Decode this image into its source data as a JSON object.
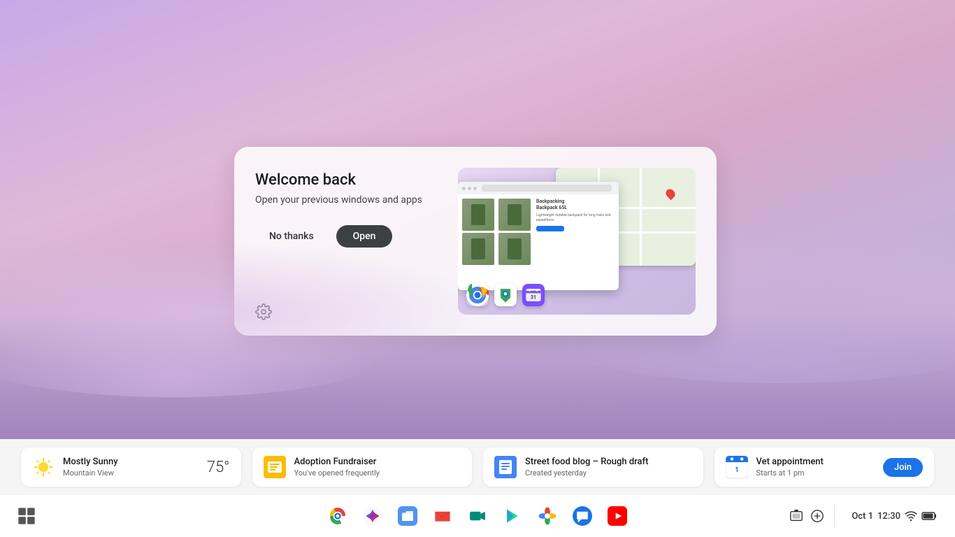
{
  "desktop": {
    "wallpaper_description": "purple pink pastel gradient with misty clouds"
  },
  "welcome_card": {
    "title": "Welcome back",
    "subtitle": "Open your previous windows and apps",
    "no_thanks_label": "No thanks",
    "open_label": "Open",
    "preview_apps": [
      "Google Chrome",
      "Google Maps",
      "Fantastical"
    ]
  },
  "suggestions": [
    {
      "id": "weather",
      "icon_type": "weather-sun",
      "title": "Mostly Sunny",
      "subtitle": "Mountain View",
      "extra": "75°",
      "action": null
    },
    {
      "id": "adoption-fundraiser",
      "icon_type": "keep-yellow",
      "title": "Adoption Fundraiser",
      "subtitle": "You've opened frequently",
      "action": null
    },
    {
      "id": "street-food-blog",
      "icon_type": "docs-blue",
      "title": "Street food blog – Rough draft",
      "subtitle": "Created yesterday",
      "action": null
    },
    {
      "id": "vet-appointment",
      "icon_type": "calendar",
      "title": "Vet appointment",
      "subtitle": "Starts at 1 pm",
      "action": "Join"
    }
  ],
  "shelf": {
    "left_apps": [],
    "center_apps": [
      {
        "id": "chrome",
        "label": "Google Chrome",
        "icon_type": "chrome"
      },
      {
        "id": "assistant",
        "label": "Google Assistant",
        "icon_type": "assistant"
      },
      {
        "id": "files",
        "label": "Files",
        "icon_type": "files"
      },
      {
        "id": "gmail",
        "label": "Gmail",
        "icon_type": "gmail"
      },
      {
        "id": "meet",
        "label": "Google Meet",
        "icon_type": "meet"
      },
      {
        "id": "play",
        "label": "Google Play",
        "icon_type": "play"
      },
      {
        "id": "photos",
        "label": "Google Photos",
        "icon_type": "photos"
      },
      {
        "id": "messages",
        "label": "Messages",
        "icon_type": "messages"
      },
      {
        "id": "youtube",
        "label": "YouTube",
        "icon_type": "youtube"
      }
    ],
    "system_tray": {
      "screenshot_label": "Screenshot",
      "add_label": "Add",
      "date": "Oct 1",
      "time": "12:30",
      "wifi": true,
      "battery": "full"
    }
  }
}
